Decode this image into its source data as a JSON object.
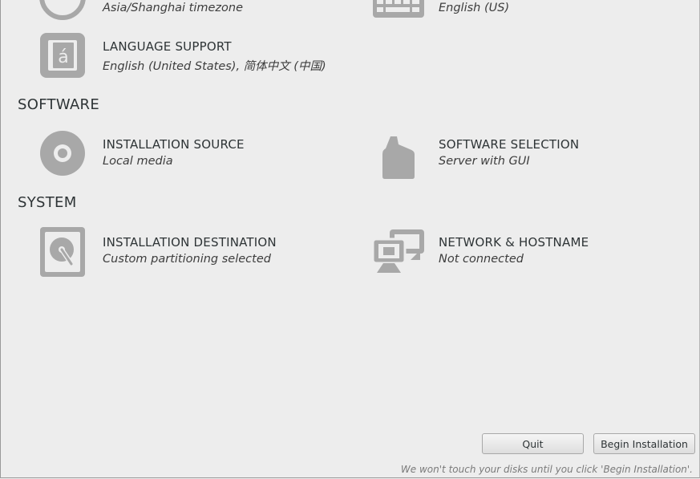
{
  "localization": {
    "timezone": {
      "status": "Asia/Shanghai timezone"
    },
    "keyboard": {
      "status": "English (US)"
    },
    "language": {
      "title": "LANGUAGE SUPPORT",
      "status": "English (United States), 简体中文 (中国)"
    }
  },
  "software": {
    "heading": "SOFTWARE",
    "source": {
      "title": "INSTALLATION SOURCE",
      "status": "Local media"
    },
    "selection": {
      "title": "SOFTWARE SELECTION",
      "status": "Server with GUI"
    }
  },
  "system": {
    "heading": "SYSTEM",
    "destination": {
      "title": "INSTALLATION DESTINATION",
      "status": "Custom partitioning selected"
    },
    "network": {
      "title": "NETWORK & HOSTNAME",
      "status": "Not connected"
    }
  },
  "footer": {
    "quit_label": "Quit",
    "begin_label": "Begin Installation",
    "hint": "We won't touch your disks until you click 'Begin Installation'."
  },
  "icons": {
    "timezone": "clock-icon",
    "keyboard": "keyboard-icon",
    "language": "language-icon",
    "source": "disc-icon",
    "selection": "package-icon",
    "destination": "harddisk-icon",
    "network": "network-icon"
  },
  "colors": {
    "background": "#ededed",
    "icon": "#a8a8a8",
    "text": "#2e3436"
  }
}
